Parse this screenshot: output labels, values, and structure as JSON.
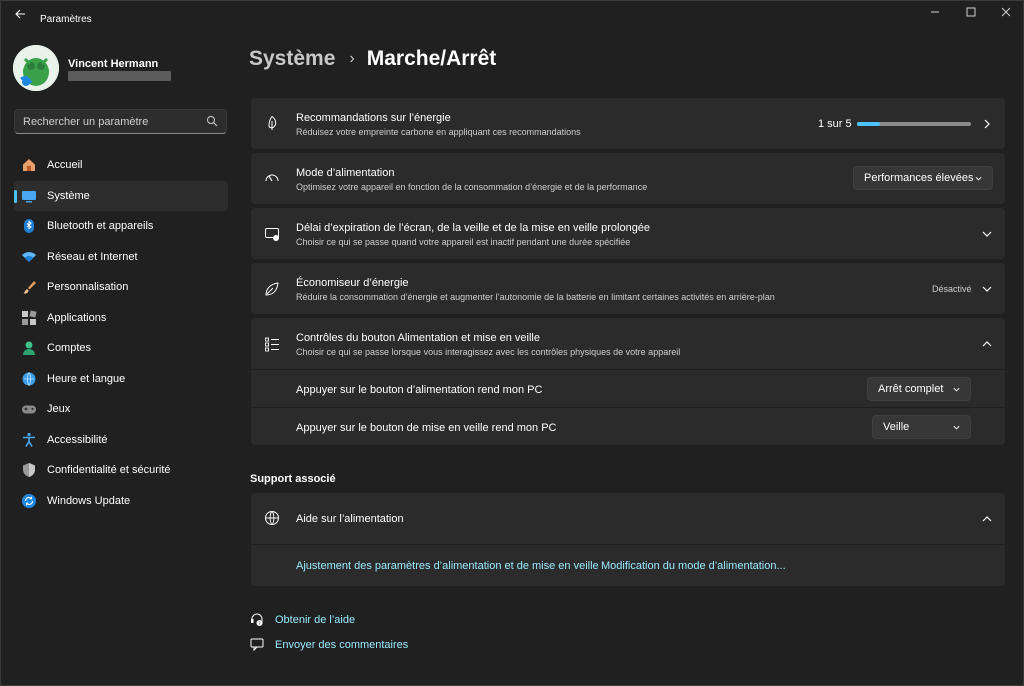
{
  "window": {
    "title": "Paramètres"
  },
  "profile": {
    "name": "Vincent Hermann"
  },
  "search": {
    "placeholder": "Rechercher un paramètre"
  },
  "nav": {
    "items": [
      {
        "label": "Accueil",
        "icon": "home-icon"
      },
      {
        "label": "Système",
        "icon": "system-icon"
      },
      {
        "label": "Bluetooth et appareils",
        "icon": "bluetooth-icon"
      },
      {
        "label": "Réseau et Internet",
        "icon": "network-icon"
      },
      {
        "label": "Personnalisation",
        "icon": "personalization-icon"
      },
      {
        "label": "Applications",
        "icon": "apps-icon"
      },
      {
        "label": "Comptes",
        "icon": "accounts-icon"
      },
      {
        "label": "Heure et langue",
        "icon": "time-language-icon"
      },
      {
        "label": "Jeux",
        "icon": "gaming-icon"
      },
      {
        "label": "Accessibilité",
        "icon": "accessibility-icon"
      },
      {
        "label": "Confidentialité et sécurité",
        "icon": "privacy-icon"
      },
      {
        "label": "Windows Update",
        "icon": "windows-update-icon"
      }
    ],
    "active": "Système"
  },
  "breadcrumb": {
    "parent": "Système",
    "separator": "›",
    "current": "Marche/Arrêt"
  },
  "cards": {
    "energy": {
      "title": "Recommandations sur l’énergie",
      "desc": "Réduisez votre empreinte carbone en appliquant ces recommandations",
      "progress_label": "1 sur 5",
      "progress_value": 0.2
    },
    "power_mode": {
      "title": "Mode d’alimentation",
      "desc": "Optimisez votre appareil en fonction de la consommation d’énergie et de la performance",
      "value": "Performances élevées"
    },
    "timeout": {
      "title": "Délai d’expiration de l’écran, de la veille et de la mise en veille prolongée",
      "desc": "Choisir ce qui se passe quand votre appareil est inactif pendant une durée spécifiée"
    },
    "saver": {
      "title": "Économiseur d’énergie",
      "desc": "Réduire la consommation d’énergie et augmenter l’autonomie de la batterie en limitant certaines activités en arrière-plan",
      "status": "Désactivé"
    },
    "buttons": {
      "title": "Contrôles du bouton Alimentation et mise en veille",
      "desc": "Choisir ce qui se passe lorsque vous interagissez avec les contrôles physiques de votre appareil",
      "rows": [
        {
          "label": "Appuyer sur le bouton d’alimentation rend mon PC",
          "value": "Arrêt complet"
        },
        {
          "label": "Appuyer sur le bouton de mise en veille rend mon PC",
          "value": "Veille"
        }
      ]
    }
  },
  "support": {
    "section_title": "Support associé",
    "help_title": "Aide sur l’alimentation",
    "links": [
      "Ajustement des paramètres d’alimentation et de mise en veille",
      "Modification du mode d’alimentation..."
    ]
  },
  "footer": {
    "get_help": "Obtenir de l’aide",
    "feedback": "Envoyer des commentaires"
  },
  "colors": {
    "accent": "#4cc2ff",
    "link": "#99ebff",
    "background": "#202020",
    "card": "#2b2b2b"
  }
}
